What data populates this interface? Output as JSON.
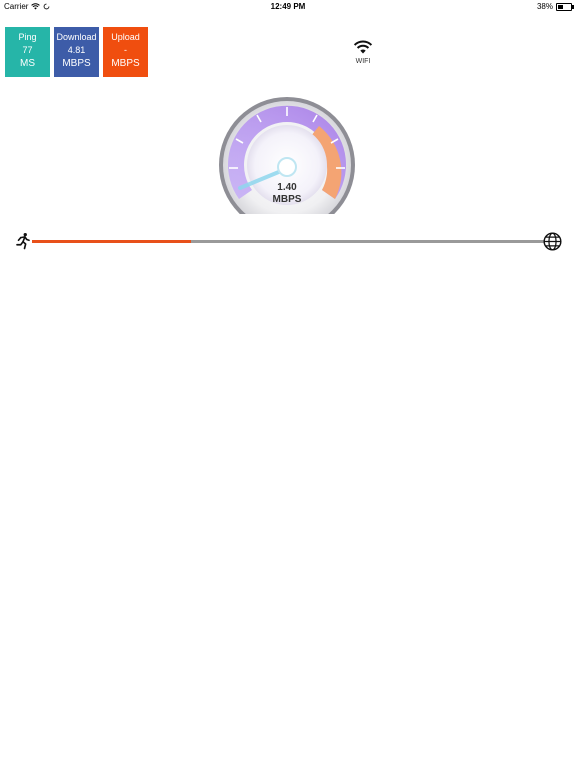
{
  "status_bar": {
    "carrier": "Carrier",
    "time": "12:49 PM",
    "battery": "38%"
  },
  "stats": {
    "ping": {
      "title": "Ping",
      "value": "77",
      "unit": "MS",
      "color": "#26b5a8"
    },
    "download": {
      "title": "Download",
      "value": "4.81",
      "unit": "MBPS",
      "color": "#3d5ca8"
    },
    "upload": {
      "title": "Upload",
      "value": "-",
      "unit": "MBPS",
      "color": "#f04e0f"
    }
  },
  "connection": {
    "label": "WIFI",
    "icon": "wifi-icon"
  },
  "gauge": {
    "value": "1.40",
    "unit": "MBPS",
    "accent_colors": [
      "#b890f0",
      "#f3a06b"
    ]
  },
  "progress": {
    "fraction": 0.31,
    "color": "#e8501a",
    "start_icon": "runner-icon",
    "end_icon": "globe-icon"
  }
}
